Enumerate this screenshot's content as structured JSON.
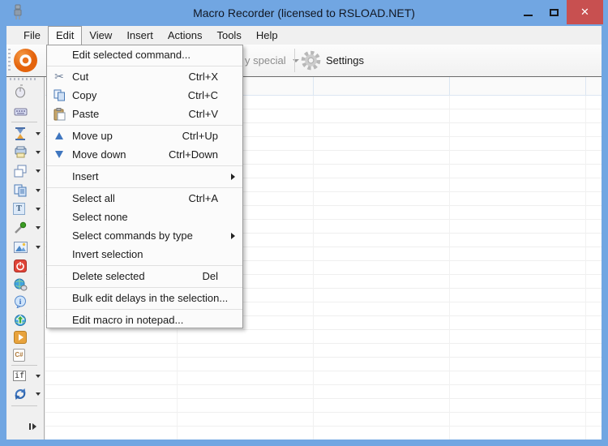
{
  "window": {
    "title": "Macro Recorder (licensed to RSLOAD.NET)",
    "close_glyph": "✕",
    "controls": [
      "minimize-button",
      "maximize-button",
      "close-button"
    ]
  },
  "menubar": {
    "items": [
      "File",
      "Edit",
      "View",
      "Insert",
      "Actions",
      "Tools",
      "Help"
    ],
    "open_item": "Edit"
  },
  "edit_menu": {
    "items": [
      {
        "label": "Edit selected command...",
        "shortcut": ""
      },
      {
        "label": "Cut",
        "shortcut": "Ctrl+X",
        "icon": "cut-icon"
      },
      {
        "label": "Copy",
        "shortcut": "Ctrl+C",
        "icon": "copy-icon"
      },
      {
        "label": "Paste",
        "shortcut": "Ctrl+V",
        "icon": "paste-icon"
      },
      {
        "label": "Move up",
        "shortcut": "Ctrl+Up",
        "icon": "move-up-icon"
      },
      {
        "label": "Move down",
        "shortcut": "Ctrl+Down",
        "icon": "move-down-icon"
      },
      {
        "label": "Insert",
        "shortcut": "",
        "submenu": true
      },
      {
        "label": "Select all",
        "shortcut": "Ctrl+A"
      },
      {
        "label": "Select none",
        "shortcut": ""
      },
      {
        "label": "Select commands by type",
        "shortcut": "",
        "submenu": true
      },
      {
        "label": "Invert selection",
        "shortcut": ""
      },
      {
        "label": "Delete selected",
        "shortcut": "Del"
      },
      {
        "label": "Bulk edit delays in the selection...",
        "shortcut": ""
      },
      {
        "label": "Edit macro in notepad...",
        "shortcut": ""
      }
    ]
  },
  "toolbar": {
    "clipped_item_label": "y special",
    "settings_label": "Settings",
    "icons": [
      "dropdown-arrow-icon",
      "gear-icon"
    ]
  },
  "sidebar": {
    "tools": [
      {
        "name": "record-button",
        "icon": "record-icon"
      },
      {
        "name": "mouse-tool",
        "icon": "mouse-icon"
      },
      {
        "name": "keyboard-tool",
        "icon": "keyboard-icon"
      },
      {
        "name": "delay-tool",
        "icon": "hourglass-icon",
        "dropdown": true
      },
      {
        "name": "printer-tool",
        "icon": "printer-icon",
        "dropdown": true
      },
      {
        "name": "window-tool",
        "icon": "windows-icon",
        "dropdown": true
      },
      {
        "name": "clipboard-tool",
        "icon": "copy-docs-icon",
        "dropdown": true
      },
      {
        "name": "text-tool",
        "icon": "text-icon",
        "dropdown": true
      },
      {
        "name": "color-picker-tool",
        "icon": "eyedropper-icon",
        "dropdown": true
      },
      {
        "name": "image-tool",
        "icon": "image-icon",
        "dropdown": true
      },
      {
        "name": "shutdown-tool",
        "icon": "power-icon"
      },
      {
        "name": "web-mouse-tool",
        "icon": "globe-mouse-icon"
      },
      {
        "name": "tooltip-tool",
        "icon": "info-icon"
      },
      {
        "name": "upload-tool",
        "icon": "globe-upload-icon"
      },
      {
        "name": "run-program-tool",
        "icon": "play-icon"
      },
      {
        "name": "csharp-tool",
        "icon": "csharp-icon"
      },
      {
        "name": "if-tool",
        "icon": "if-icon",
        "dropdown": true
      },
      {
        "name": "loop-tool",
        "icon": "loop-icon",
        "dropdown": true
      }
    ],
    "glyphs": {
      "text_tool": "T",
      "csharp_tool": "C#",
      "if_tool": "if"
    }
  },
  "table": {
    "state": "empty",
    "visible_columns": 5
  },
  "colors": {
    "titlebar_blue": "#71A6E2",
    "close_red": "#C85050",
    "record_orange": "#E9701A",
    "move_arrow_blue": "#3F76BF",
    "menu_bg": "#FBFBFB",
    "chrome_bg": "#F0F0F0"
  }
}
